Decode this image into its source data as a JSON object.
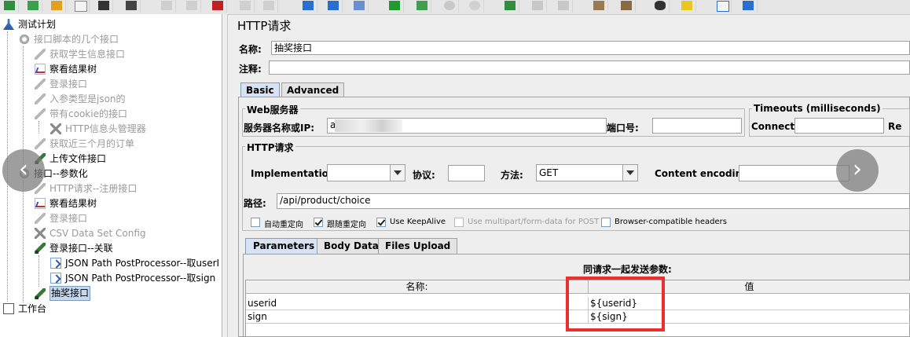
{
  "tree": {
    "items": [
      {
        "label": "测试计划"
      },
      {
        "label": "接口脚本的几个接口"
      },
      {
        "label": "获取学生信息接口"
      },
      {
        "label": "察看结果树"
      },
      {
        "label": "登录接口"
      },
      {
        "label": "入参类型是json的"
      },
      {
        "label": "带有cookie的接口"
      },
      {
        "label": "HTTP信息头管理器"
      },
      {
        "label": "获取近三个月的订单"
      },
      {
        "label": "上传文件接口"
      },
      {
        "label": "接口--参数化"
      },
      {
        "label": "HTTP请求--注册接口"
      },
      {
        "label": "察看结果树"
      },
      {
        "label": "登录接口"
      },
      {
        "label": "CSV Data Set Config"
      },
      {
        "label": "登录接口--关联"
      },
      {
        "label": "JSON Path PostProcessor--取userI"
      },
      {
        "label": "JSON Path PostProcessor--取sign"
      },
      {
        "label": "抽奖接口"
      },
      {
        "label": "工作台"
      }
    ]
  },
  "nav": {
    "prev": "‹",
    "next": "›"
  },
  "panel": {
    "title": "HTTP请求",
    "name_label": "名称:",
    "name_value": "抽奖接口",
    "comment_label": "注释:",
    "comment_value": "",
    "tabs": [
      "Basic",
      "Advanced"
    ],
    "web_server": {
      "group_title": "Web服务器",
      "server_label": "服务器名称或IP:",
      "server_value": "a",
      "port_label": "端口号:",
      "port_value": ""
    },
    "timeouts": {
      "group_title": "Timeouts (milliseconds)",
      "connect_label": "Connect:",
      "connect_value": "",
      "response_label": "Re"
    },
    "http_request": {
      "group_title": "HTTP请求",
      "impl_label": "Implementation:",
      "impl_value": "",
      "protocol_label": "协议:",
      "protocol_value": "",
      "method_label": "方法:",
      "method_value": "GET",
      "encoding_label": "Content encoding:",
      "encoding_value": "",
      "path_label": "路径:",
      "path_value": "/api/product/choice"
    },
    "checkboxes": [
      {
        "label": "自动重定向",
        "checked": false,
        "disabled": false
      },
      {
        "label": "跟随重定向",
        "checked": true,
        "disabled": false
      },
      {
        "label": "Use KeepAlive",
        "checked": true,
        "disabled": false
      },
      {
        "label": "Use multipart/form-data for POST",
        "checked": false,
        "disabled": true
      },
      {
        "label": "Browser-compatible headers",
        "checked": false,
        "disabled": false
      }
    ],
    "param_tabs": [
      "Parameters",
      "Body Data",
      "Files Upload"
    ],
    "params": {
      "caption": "同请求一起发送参数:",
      "columns": [
        "名称:",
        "值"
      ],
      "rows": [
        {
          "name": "userid",
          "value": "${userid}"
        },
        {
          "name": "sign",
          "value": "${sign}"
        }
      ]
    }
  },
  "colors": {
    "highlight": "#e8312f",
    "selection": "#c6d8f0"
  }
}
